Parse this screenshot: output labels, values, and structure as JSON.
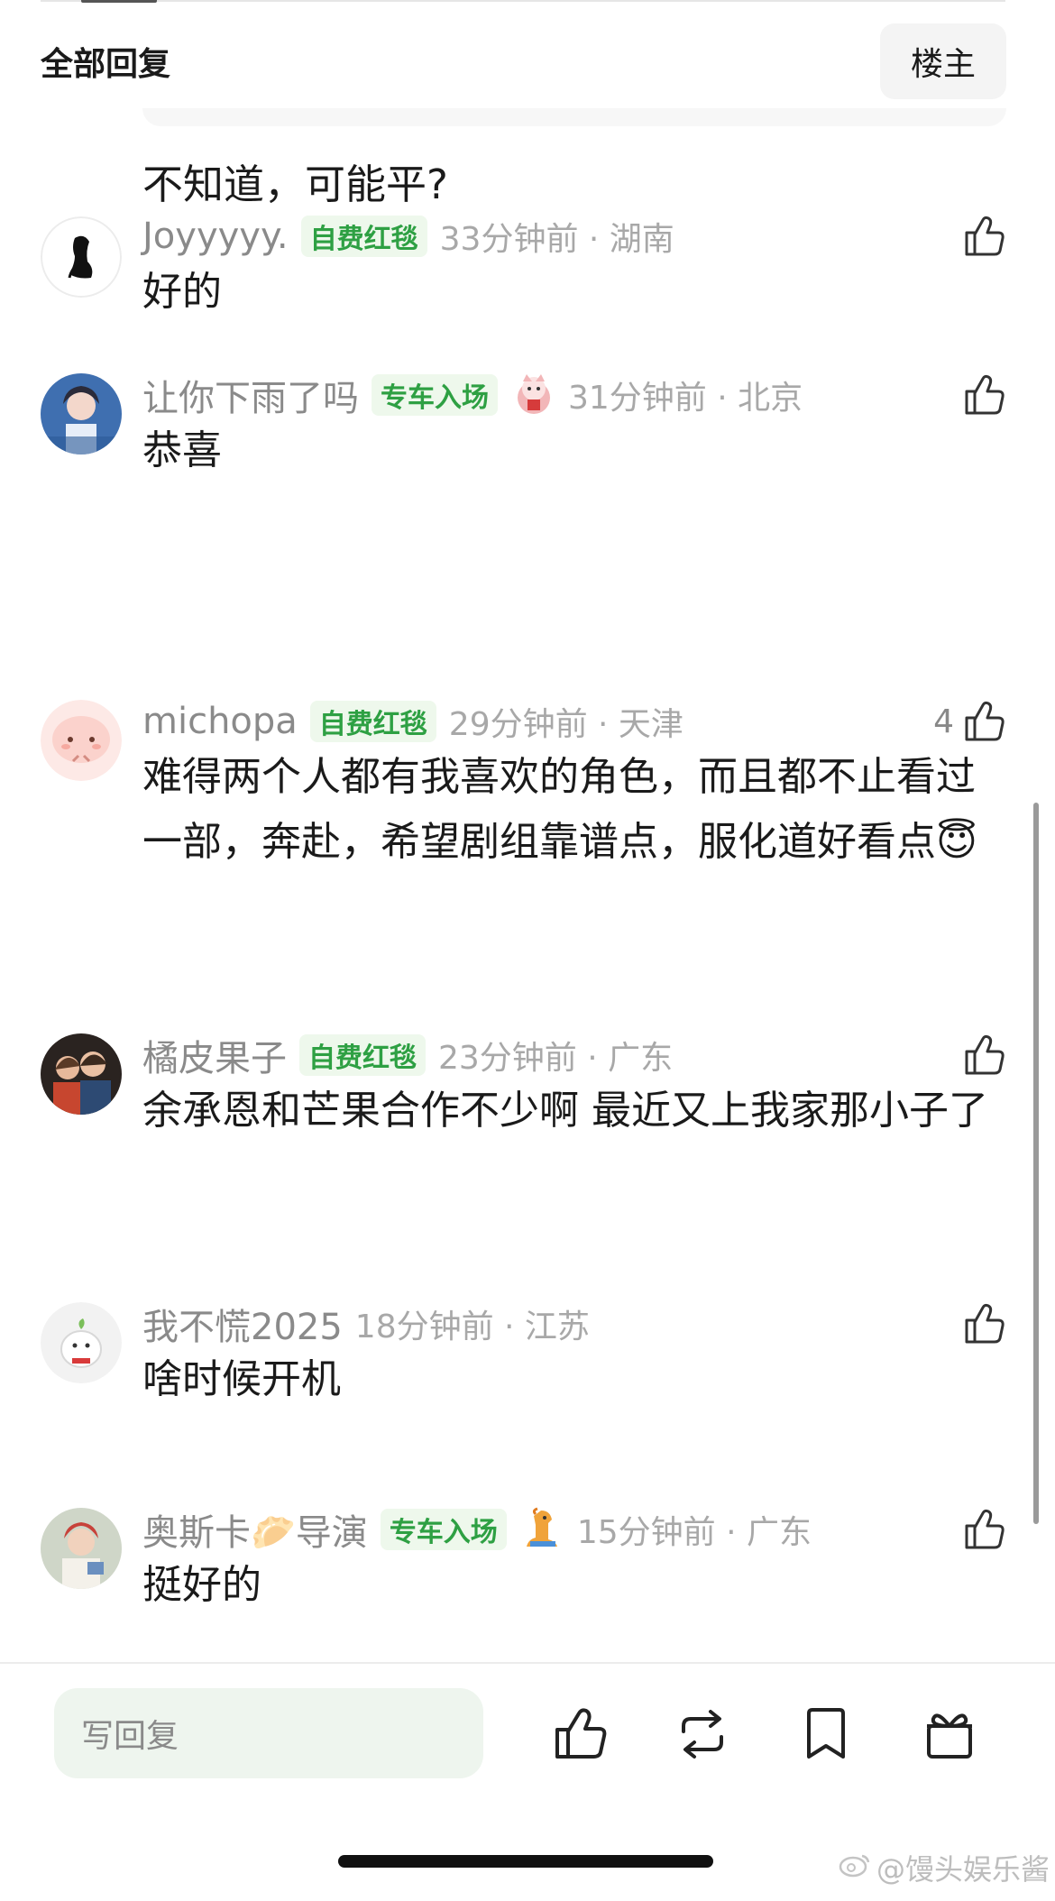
{
  "header": {
    "title": "全部回复",
    "owner_button": "楼主"
  },
  "previous_reply": {
    "text": "不知道，可能平?"
  },
  "comments": [
    {
      "username": "Joyyyyy.",
      "badge": "自费红毯",
      "time_location": "33分钟前 · 湖南",
      "likes": "",
      "text": "好的"
    },
    {
      "username": "让你下雨了吗",
      "badge": "专车入场",
      "time_location": "31分钟前 · 北京",
      "likes": "",
      "text": "恭喜"
    },
    {
      "username": "michopa",
      "badge": "自费红毯",
      "time_location": "29分钟前 · 天津",
      "likes": "4",
      "text": "难得两个人都有我喜欢的角色，而且都不止看过一部，奔赴，希望剧组靠谱点，服化道好看点😇"
    },
    {
      "username": "橘皮果子",
      "badge": "自费红毯",
      "time_location": "23分钟前 · 广东",
      "likes": "",
      "text": "余承恩和芒果合作不少啊  最近又上我家那小子了"
    },
    {
      "username": "我不慌2025",
      "badge": "",
      "time_location": "18分钟前 · 江苏",
      "likes": "",
      "text": "啥时候开机"
    },
    {
      "username": "奥斯卡🥟导演",
      "badge": "专车入场",
      "time_location": "15分钟前 · 广东",
      "likes": "",
      "text": "挺好的"
    }
  ],
  "bottom_bar": {
    "reply_placeholder": "写回复"
  },
  "watermark": "@馒头娱乐酱",
  "colors": {
    "badge_green": "#2ea043",
    "badge_bg": "#eef8ec",
    "meta_gray": "#8a8a8a",
    "input_bg": "#eef5ee"
  },
  "icons": [
    "thumbs-up-icon",
    "repost-icon",
    "bookmark-icon",
    "gift-icon",
    "weibo-icon"
  ]
}
